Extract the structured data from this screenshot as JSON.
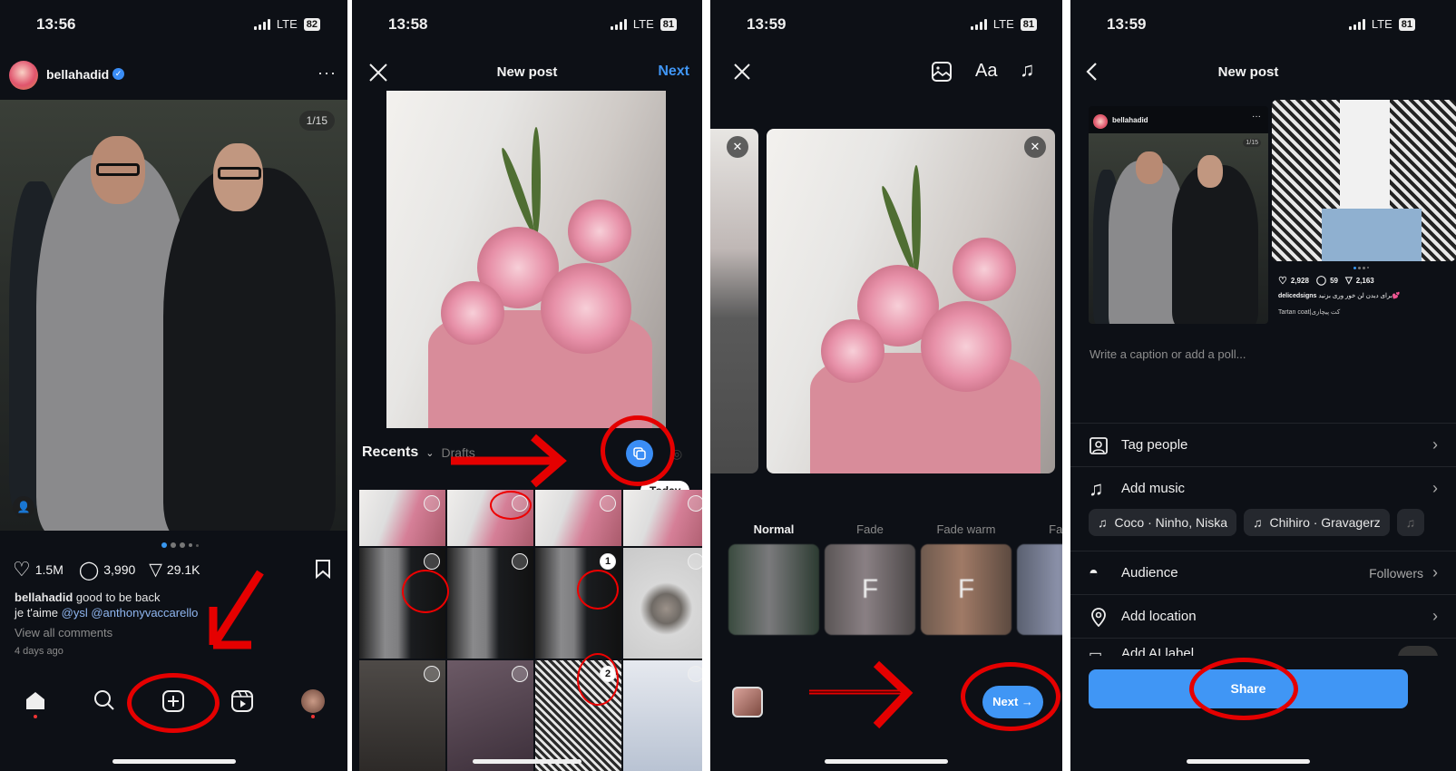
{
  "panel1": {
    "status": {
      "time": "13:56",
      "network": "LTE",
      "battery": "82"
    },
    "post": {
      "username": "bellahadid",
      "verified": true,
      "more_icon": "more-horizontal-icon",
      "counter": "1/15",
      "likes": "1.5M",
      "comments": "3,990",
      "shares": "29.1K",
      "caption_user": "bellahadid",
      "caption_text": "good to be back",
      "caption_line2_prefix": "je t'aime",
      "mention1": "@ysl",
      "mention2": "@anthonyvaccarello",
      "view_comments": "View all comments",
      "time_ago": "4 days ago"
    },
    "nav": [
      "home-icon",
      "search-icon",
      "create-post-icon",
      "reels-icon",
      "profile-avatar"
    ],
    "annotation": "Tap the + (create) button"
  },
  "panel2": {
    "status": {
      "time": "13:58",
      "network": "LTE",
      "battery": "81"
    },
    "header": {
      "title": "New post",
      "next_label": "Next",
      "close_icon": "close-icon"
    },
    "gallery": {
      "album_label": "Recents",
      "drafts_label": "Drafts",
      "today_badge": "Today",
      "multi_select_icon": "select-multiple-icon",
      "camera_icon": "camera-icon"
    },
    "thumbnails": [
      {
        "subject": "lilies",
        "selected": ""
      },
      {
        "subject": "lilies",
        "selected": ""
      },
      {
        "subject": "lilies",
        "selected": ""
      },
      {
        "subject": "lilies",
        "selected": ""
      },
      {
        "subject": "suits",
        "selected": ""
      },
      {
        "subject": "suits",
        "selected": ""
      },
      {
        "subject": "suits",
        "selected": "1"
      },
      {
        "subject": "cat",
        "selected": ""
      },
      {
        "subject": "topics-list",
        "selected": ""
      },
      {
        "subject": "home-screen",
        "selected": ""
      },
      {
        "subject": "tartan-coat",
        "selected": "2"
      },
      {
        "subject": "document",
        "selected": ""
      }
    ]
  },
  "panel3": {
    "status": {
      "time": "13:59",
      "network": "LTE",
      "battery": "81"
    },
    "toolbar": {
      "close_icon": "close-icon",
      "image_icon": "image-icon",
      "text_label": "Aa",
      "music_icon": "music-icon"
    },
    "filters": [
      {
        "name": "Normal",
        "active": true,
        "mark": ""
      },
      {
        "name": "Fade",
        "active": false,
        "mark": "F"
      },
      {
        "name": "Fade warm",
        "active": false,
        "mark": "F"
      },
      {
        "name": "Fade",
        "active": false,
        "mark": ""
      }
    ],
    "next_label": "Next →"
  },
  "panel4": {
    "status": {
      "time": "13:59",
      "network": "LTE",
      "battery": "81"
    },
    "header": {
      "title": "New post",
      "back_icon": "back-chevron-icon"
    },
    "preview1": {
      "username": "bellahadid",
      "counter": "1/15"
    },
    "preview2": {
      "likes": "2,928",
      "comments": "59",
      "shares": "2,163",
      "username": "delicedsigns",
      "caption": "برای دیدن لن خور وری بزنید💕",
      "subcaption": "Tartan coat|کت پیچازی"
    },
    "caption_placeholder": "Write a caption or add a poll...",
    "options": [
      {
        "label": "Tag people",
        "icon": "tag-people-icon",
        "value": ""
      },
      {
        "label": "Add music",
        "icon": "music-icon",
        "value": ""
      }
    ],
    "music_chips": [
      "Coco · Ninho, Niska",
      "Chihiro · Gravagerz"
    ],
    "options2": [
      {
        "label": "Audience",
        "icon": "audience-icon",
        "value": "Followers"
      },
      {
        "label": "Add location",
        "icon": "location-pin-icon",
        "value": ""
      },
      {
        "label": "Add AI label",
        "icon": "ai-label-icon",
        "value": ""
      }
    ],
    "share_label": "Share"
  },
  "colors": {
    "accent": "#4096f5",
    "annotation": "#e50000",
    "background": "#0d1016"
  }
}
